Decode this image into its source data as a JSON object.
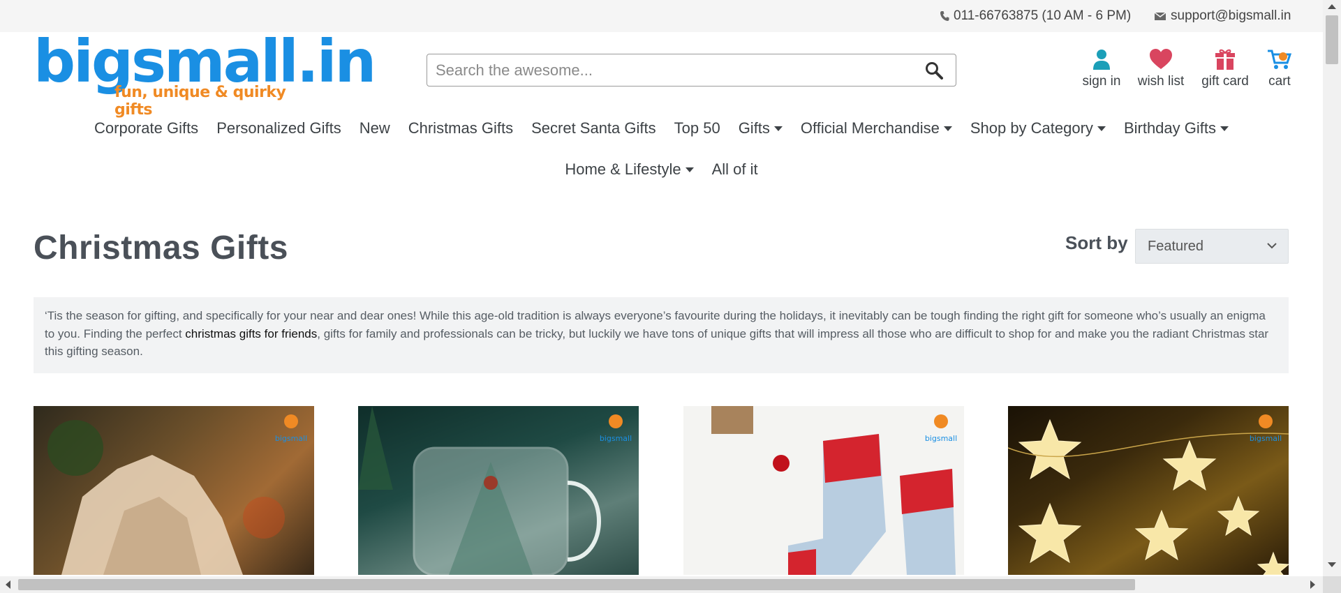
{
  "topbar": {
    "phone": "011-66763875 (10 AM - 6 PM)",
    "email": "support@bigsmall.in",
    "phone_icon": "phone-icon",
    "email_icon": "envelope-icon"
  },
  "logo": {
    "wordmark": "bigsmall.in",
    "tagline": "fun, unique & quirky gifts"
  },
  "search": {
    "placeholder": "Search the awesome...",
    "value": "",
    "icon": "search-icon"
  },
  "header_icons": {
    "signin": {
      "label": "sign in",
      "icon": "user-icon",
      "color": "#1b9fb8"
    },
    "wishlist": {
      "label": "wish list",
      "icon": "heart-icon",
      "color": "#d9455f"
    },
    "giftcard": {
      "label": "gift card",
      "icon": "gift-icon",
      "color": "#d9455f"
    },
    "cart": {
      "label": "cart",
      "icon": "cart-icon",
      "color": "#1a8fe3"
    }
  },
  "nav": {
    "row1": [
      {
        "label": "Corporate Gifts",
        "dropdown": false
      },
      {
        "label": "Personalized Gifts",
        "dropdown": false
      },
      {
        "label": "New",
        "dropdown": false
      },
      {
        "label": "Christmas Gifts",
        "dropdown": false
      },
      {
        "label": "Secret Santa Gifts",
        "dropdown": false
      },
      {
        "label": "Top 50",
        "dropdown": false
      },
      {
        "label": "Gifts",
        "dropdown": true
      },
      {
        "label": "Official Merchandise",
        "dropdown": true
      },
      {
        "label": "Shop by Category",
        "dropdown": true
      },
      {
        "label": "Birthday Gifts",
        "dropdown": true
      }
    ],
    "row2": [
      {
        "label": "Home & Lifestyle",
        "dropdown": true
      },
      {
        "label": "All of it",
        "dropdown": false
      }
    ]
  },
  "page": {
    "title": "Christmas Gifts",
    "sort_label": "Sort by",
    "sort_value": "Featured"
  },
  "description": {
    "before_link": "‘Tis the season for gifting, and specifically for your near and dear ones! While this age-old tradition is always everyone’s favourite during the holidays, it inevitably can be tough finding the right gift for someone who’s usually an enigma to you. Finding the perfect ",
    "link": "christmas gifts for friends",
    "after_link": ", gifts for family and professionals can be tricky, but luckily we have tons of unique gifts that will impress all those who are difficult to shop for and make you the radiant Christmas star this gifting season."
  },
  "products": [
    {
      "image": "wooden-nativity-scene-image"
    },
    {
      "image": "christmas-tree-glass-mug-image"
    },
    {
      "image": "christmas-socks-image"
    },
    {
      "image": "star-fairy-lights-image"
    }
  ],
  "colors": {
    "brand_blue": "#1a8fe3",
    "brand_orange": "#f08a24",
    "text": "#3d4246",
    "topbar_bg": "#f5f5f5",
    "desc_bg": "#f2f3f4"
  }
}
